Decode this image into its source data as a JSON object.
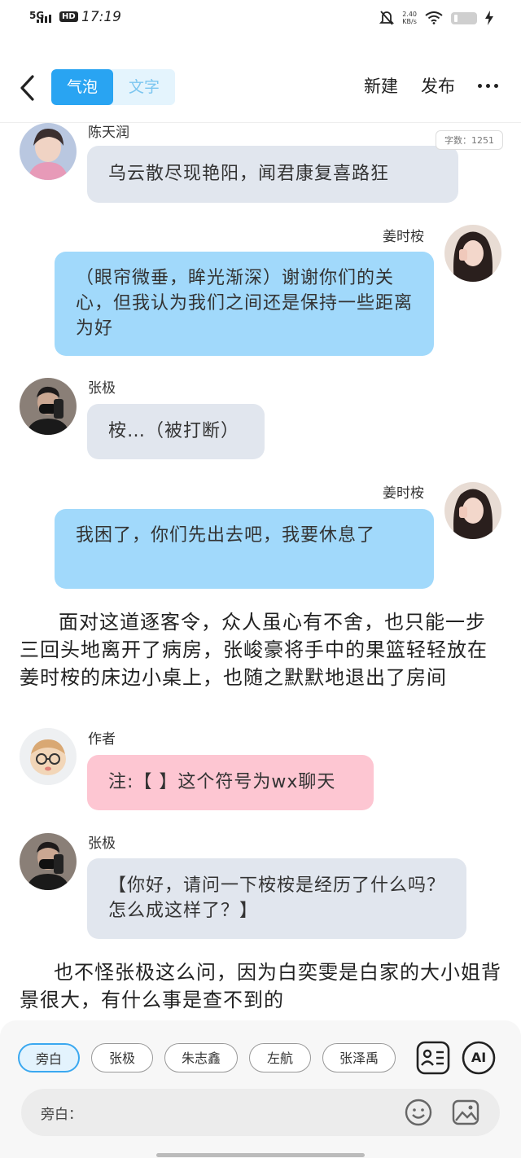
{
  "status": {
    "network": "5G",
    "hd": "HD",
    "time": "17:19",
    "speed_value": "2.40",
    "speed_unit": "KB/s"
  },
  "header": {
    "tab_bubble": "气泡",
    "tab_text": "文字",
    "new_label": "新建",
    "publish_label": "发布"
  },
  "word_count": "字数：1251",
  "messages": [
    {
      "name": "陈天润",
      "text": "乌云散尽现艳阳，闻君康复喜路狂"
    },
    {
      "name": "姜时桉",
      "text": "（眼帘微垂，眸光渐深）谢谢你们的关心，但我认为我们之间还是保持一些距离为好"
    },
    {
      "name": "张极",
      "text": "桉…（被打断）"
    },
    {
      "name": "姜时桉",
      "text": "我困了，你们先出去吧，我要休息了"
    },
    {
      "name": "作者",
      "text": "注:【 】这个符号为wx聊天"
    },
    {
      "name": "张极",
      "text": "【你好，请问一下桉桉是经历了什么吗？怎么成这样了？】"
    }
  ],
  "narration": [
    "面对这道逐客令，众人虽心有不舍，也只能一步三回头地离开了病房，张峻豪将手中的果篮轻轻放在姜时桉的床边小桌上，也随之默默地退出了房间",
    "也不怪张极这么问，因为白奕雯是白家的大小姐背景很大，有什么事是查不到的"
  ],
  "roles": [
    "旁白",
    "张极",
    "朱志鑫",
    "左航",
    "张泽禹"
  ],
  "input": {
    "label": "旁白："
  },
  "icons": {
    "ai_label": "AI"
  }
}
